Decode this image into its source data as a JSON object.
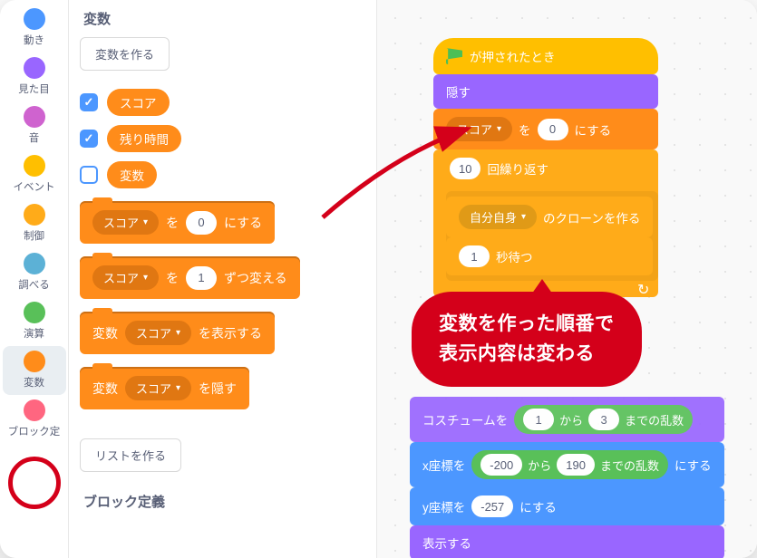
{
  "categories": [
    {
      "label": "動き",
      "color": "#4c97ff"
    },
    {
      "label": "見た目",
      "color": "#9966ff"
    },
    {
      "label": "音",
      "color": "#cf63cf"
    },
    {
      "label": "イベント",
      "color": "#ffbf00"
    },
    {
      "label": "制御",
      "color": "#ffab19"
    },
    {
      "label": "調べる",
      "color": "#5cb1d6"
    },
    {
      "label": "演算",
      "color": "#59c059"
    },
    {
      "label": "変数",
      "color": "#ff8c1a"
    },
    {
      "label": "ブロック定",
      "color": "#ff6680"
    }
  ],
  "palette": {
    "section_vars": "変数",
    "make_var": "変数を作る",
    "vars": [
      {
        "name": "スコア",
        "checked": true
      },
      {
        "name": "残り時間",
        "checked": true
      },
      {
        "name": "変数",
        "checked": false
      }
    ],
    "blk_set": {
      "var": "スコア",
      "mid": "を",
      "val": "0",
      "suf": "にする"
    },
    "blk_change": {
      "var": "スコア",
      "mid": "を",
      "val": "1",
      "suf": "ずつ変える"
    },
    "blk_show": {
      "pre": "変数",
      "var": "スコア",
      "suf": "を表示する"
    },
    "blk_hide": {
      "pre": "変数",
      "var": "スコア",
      "suf": "を隠す"
    },
    "make_list": "リストを作る",
    "section_myblocks": "ブロック定義"
  },
  "scripts": {
    "hat": "が押されたとき",
    "hide": "隠す",
    "set_score": {
      "var": "スコア",
      "mid": "を",
      "val": "0",
      "suf": "にする"
    },
    "repeat": {
      "count": "10",
      "label": "回繰り返す"
    },
    "clone": {
      "target": "自分自身",
      "suf": "のクローンを作る"
    },
    "wait": {
      "val": "1",
      "suf": "秒待つ"
    },
    "costume_rand": {
      "pre": "コスチュームを",
      "a": "1",
      "mid": "から",
      "b": "3",
      "suf": "までの乱数"
    },
    "setx": {
      "pre": "x座標を",
      "a": "-200",
      "mid": "から",
      "b": "190",
      "suf": "までの乱数",
      "tail": "にする"
    },
    "sety": {
      "pre": "y座標を",
      "val": "-257",
      "suf": "にする"
    },
    "show": "表示する"
  },
  "annotation": {
    "line1": "変数を作った順番で",
    "line2": "表示内容は変わる"
  }
}
